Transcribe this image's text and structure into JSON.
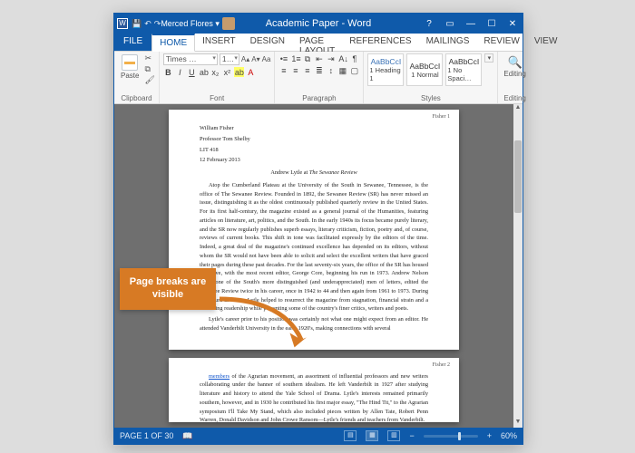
{
  "titlebar": {
    "title": "Academic Paper - Word",
    "user": "Merced Flores ▾"
  },
  "tabs": [
    "FILE",
    "HOME",
    "INSERT",
    "DESIGN",
    "PAGE LAYOUT",
    "REFERENCES",
    "MAILINGS",
    "REVIEW",
    "VIEW"
  ],
  "ribbon": {
    "clipboard": {
      "paste": "Paste",
      "label": "Clipboard"
    },
    "font": {
      "family": "Times …",
      "size": "1…",
      "label": "Font"
    },
    "paragraph": {
      "label": "Paragraph"
    },
    "styles": {
      "sample": "AaBbCcI",
      "cards": [
        "1 Heading 1",
        "1 Normal",
        "1 No Spaci…"
      ],
      "label": "Styles"
    },
    "editing": {
      "find": "Editing",
      "label": "Editing"
    }
  },
  "doc": {
    "folio1": "Fisher 1",
    "folio2": "Fisher 2",
    "header": [
      "William Fisher",
      "Professor Tom Shelby",
      "LIT 418",
      "12 February 2013"
    ],
    "title_a": "Andrew Lytle at",
    "title_b": "The Sewanee Review",
    "body1": "Atop the Cumberland Plateau at the University of the South in Sewanee, Tennessee, is the office of The Sewanee Review. Founded in 1892, the Sewanee Review (SR) has never missed an issue, distinguishing it as the oldest continuously published quarterly review in the United States. For its first half-century, the magazine existed as a general journal of the Humanities, featuring articles on literature, art, politics, and the South. In the early 1940s its focus became purely literary, and the SR now regularly publishes superb essays, literary criticism, fiction, poetry and, of course, reviews of current books. This shift in tone was facilitated expressly by the editors of the time. Indeed, a great deal of the magazine's continued excellence has depended on its editors, without whom the SR would not have been able to solicit and select the excellent writers that have graced their pages during these past decades. For the last seventy-six years, the office of the SR has housed only five, with the most recent editor, George Core, beginning his run in 1973. Andrew Nelson Lytle, one of the South's more distinguished (and underappreciated) men of letters, edited the Sewanee Review twice in his career, once in 1942 to 44 and then again from 1961 to 1973. During his tenure as editor, Lytle helped to resurrect the magazine from stagnation, financial strain and a dwindling readership while presenting some of the country's finer critics, writers and poets.",
    "body2": "Lytle's career prior to his position was certainly not what one might expect from an editor. He attended Vanderbilt University in the early 1920's, making connections with several",
    "body3link": "members",
    "body3": "of the Agrarian movement, an assortment of influential professors and new writers collaborating under the banner of southern idealism. He left Vanderbilt in 1927 after studying literature and history to attend the Yale School of Drama. Lytle's interests remained primarily southern, however, and in 1930 he contributed his first major essay, \"The Hind Tit,\" to the Agrarian symposium I'll Take My Stand, which also included pieces written by Allen Tate, Robert Penn Warren, Donald Davidson and John Crowe Ransom—Lytle's friends and teachers from Vanderbilt."
  },
  "status": {
    "page": "PAGE 1 OF 30",
    "zoom": "60%"
  },
  "callout": {
    "text": "Page breaks are visible"
  }
}
